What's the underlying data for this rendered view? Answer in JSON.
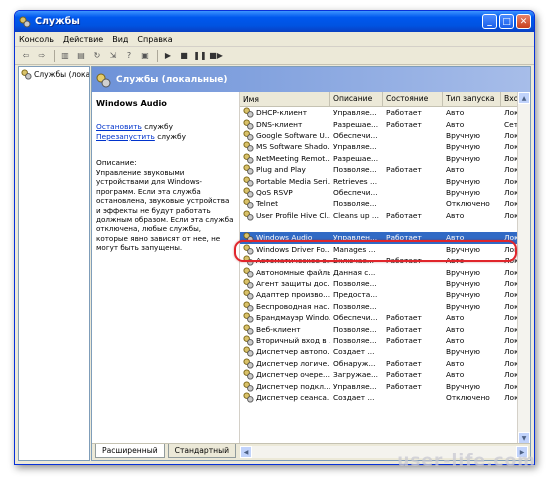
{
  "window": {
    "title": "Службы"
  },
  "menu": [
    "Консоль",
    "Действие",
    "Вид",
    "Справка"
  ],
  "tree": {
    "root": "Службы (лока"
  },
  "panel": {
    "header": "Службы (локальные)"
  },
  "description": {
    "service_name": "Windows Audio",
    "stop_link": "Остановить",
    "stop_suffix": " службу",
    "restart_link": "Перезапустить",
    "restart_suffix": " службу",
    "label": "Описание:",
    "text": "Управление звуковыми устройствами для Windows-программ. Если эта служба остановлена, звуковые устройства и эффекты не будут работать должным образом. Если эта служба отключена, любые службы, которые явно зависят от нее, не могут быть запущены."
  },
  "columns": [
    "Имя",
    "Описание",
    "Состояние",
    "Тип запуска",
    "Вход"
  ],
  "rows": [
    {
      "name": "DHCP-клиент",
      "desc": "Управляе...",
      "state": "Работает",
      "type": "Авто",
      "login": "Лока"
    },
    {
      "name": "DNS-клиент",
      "desc": "Разрешае...",
      "state": "Работает",
      "type": "Авто",
      "login": "Сете"
    },
    {
      "name": "Google Software U...",
      "desc": "Обеспечи...",
      "state": "",
      "type": "Вручную",
      "login": "Лока"
    },
    {
      "name": "MS Software Shado...",
      "desc": "Управляе...",
      "state": "",
      "type": "Вручную",
      "login": "Лока"
    },
    {
      "name": "NetMeeting Remot...",
      "desc": "Разрешае...",
      "state": "",
      "type": "Вручную",
      "login": "Лока"
    },
    {
      "name": "Plug and Play",
      "desc": "Позволяе...",
      "state": "Работает",
      "type": "Авто",
      "login": "Лока"
    },
    {
      "name": "Portable Media Seri...",
      "desc": "Retrieves ...",
      "state": "",
      "type": "Вручную",
      "login": "Лока"
    },
    {
      "name": "QoS RSVP",
      "desc": "Обеспечи...",
      "state": "",
      "type": "Вручную",
      "login": "Лока"
    },
    {
      "name": "Telnet",
      "desc": "Позволяе...",
      "state": "",
      "type": "Отключено",
      "login": "Лока"
    },
    {
      "name": "User Profile Hive Cl...",
      "desc": "Cleans up ...",
      "state": "Работает",
      "type": "Авто",
      "login": "Лока"
    },
    {
      "name": "",
      "desc": "",
      "state": "",
      "type": "",
      "login": ""
    },
    {
      "name": "Windows Audio",
      "desc": "Управлен...",
      "state": "Работает",
      "type": "Авто",
      "login": "Лока",
      "selected": true
    },
    {
      "name": "Windows Driver Fo...",
      "desc": "Manages ...",
      "state": "",
      "type": "Вручную",
      "login": "Лока"
    },
    {
      "name": "Автоматическое о...",
      "desc": "Включае...",
      "state": "Работает",
      "type": "Авто",
      "login": "Лока"
    },
    {
      "name": "Автономные файлы",
      "desc": "Данная с...",
      "state": "",
      "type": "Вручную",
      "login": "Лока"
    },
    {
      "name": "Агент защиты дос...",
      "desc": "Позволяе...",
      "state": "",
      "type": "Вручную",
      "login": "Лока"
    },
    {
      "name": "Адаптер произво...",
      "desc": "Предоста...",
      "state": "",
      "type": "Вручную",
      "login": "Лока"
    },
    {
      "name": "Беспроводная нас...",
      "desc": "Позволяе...",
      "state": "",
      "type": "Вручную",
      "login": "Лока"
    },
    {
      "name": "Брандмауэр Windo...",
      "desc": "Обеспечи...",
      "state": "Работает",
      "type": "Авто",
      "login": "Лока"
    },
    {
      "name": "Веб-клиент",
      "desc": "Позволяе...",
      "state": "Работает",
      "type": "Авто",
      "login": "Лока"
    },
    {
      "name": "Вторичный вход в ...",
      "desc": "Позволяе...",
      "state": "Работает",
      "type": "Авто",
      "login": "Лока"
    },
    {
      "name": "Диспетчер автопо...",
      "desc": "Создает ...",
      "state": "",
      "type": "Вручную",
      "login": "Лока"
    },
    {
      "name": "Диспетчер логиче...",
      "desc": "Обнаруж...",
      "state": "Работает",
      "type": "Авто",
      "login": "Лока"
    },
    {
      "name": "Диспетчер очере...",
      "desc": "Загружае...",
      "state": "Работает",
      "type": "Авто",
      "login": "Лока"
    },
    {
      "name": "Диспетчер подкл...",
      "desc": "Управляе...",
      "state": "Работает",
      "type": "Вручную",
      "login": "Лока"
    },
    {
      "name": "Диспетчер сеанса...",
      "desc": "Создает ...",
      "state": "",
      "type": "Отключено",
      "login": "Лока"
    }
  ],
  "tabs": [
    "Расширенный",
    "Стандартный"
  ],
  "watermark": "user-life.com",
  "colors": {
    "selection": "#316ac5",
    "highlight_ring": "#e0252b",
    "title_blue": "#0053e1"
  }
}
